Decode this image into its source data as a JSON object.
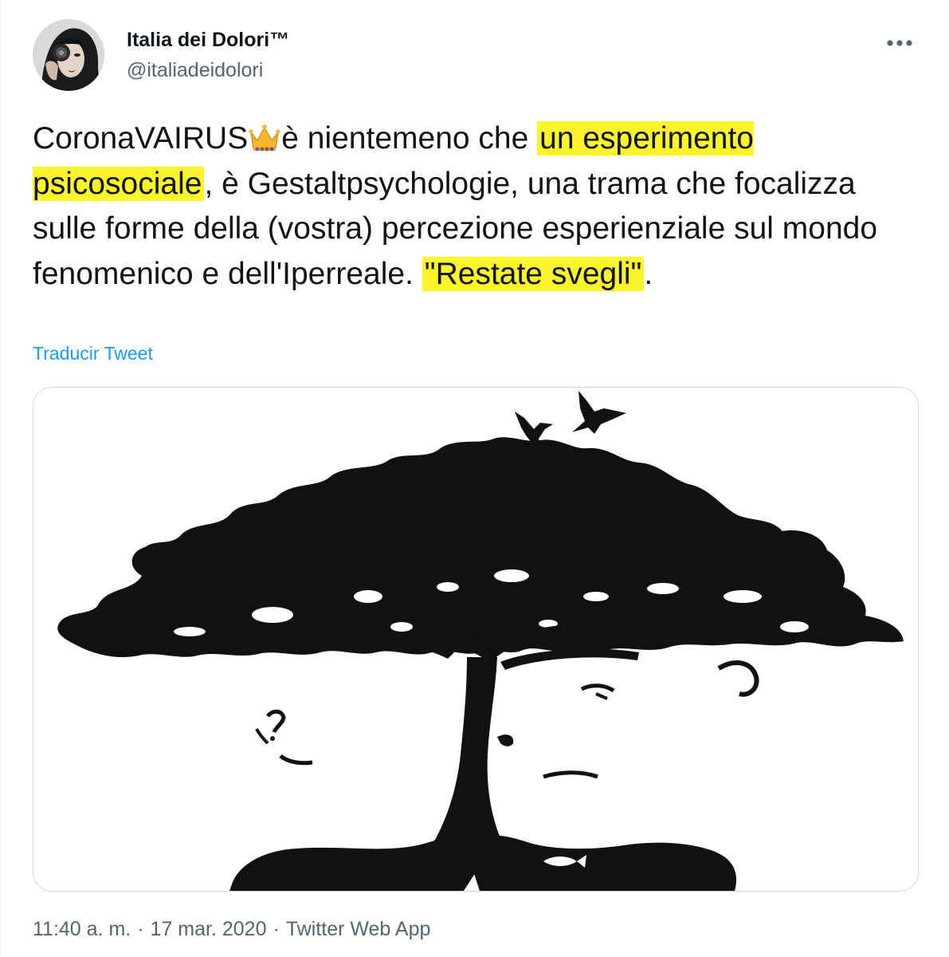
{
  "user": {
    "display_name": "Italia dei Dolori™",
    "handle": "@italiadeidolori",
    "avatar_icon": "profile-photo"
  },
  "tweet": {
    "segments": [
      {
        "text": "CoronaVAIRUS",
        "highlight": false
      },
      {
        "emoji": "crown"
      },
      {
        "text": "è nientemeno che ",
        "highlight": false
      },
      {
        "text": "un esperimento psicosociale",
        "highlight": true
      },
      {
        "text": ", è Gestaltpsychologie, una trama che focalizza sulle forme della (vostra) percezione esperienziale sul mondo fenomenico e dell'Iperreale. ",
        "highlight": false
      },
      {
        "text": "\"Restate svegli\"",
        "highlight": true
      },
      {
        "text": ".",
        "highlight": false
      }
    ],
    "highlight_color": "#fff42a"
  },
  "translate_label": "Traducir Tweet",
  "media": {
    "type": "image",
    "subject": "tree-with-two-lion-faces-illusion"
  },
  "meta": {
    "time": "11:40 a. m.",
    "separator": "·",
    "date": "17 mar. 2020",
    "source": "Twitter Web App"
  },
  "colors": {
    "link": "#1d9bf0",
    "secondary_text": "#536471",
    "primary_text": "#0f1419"
  }
}
